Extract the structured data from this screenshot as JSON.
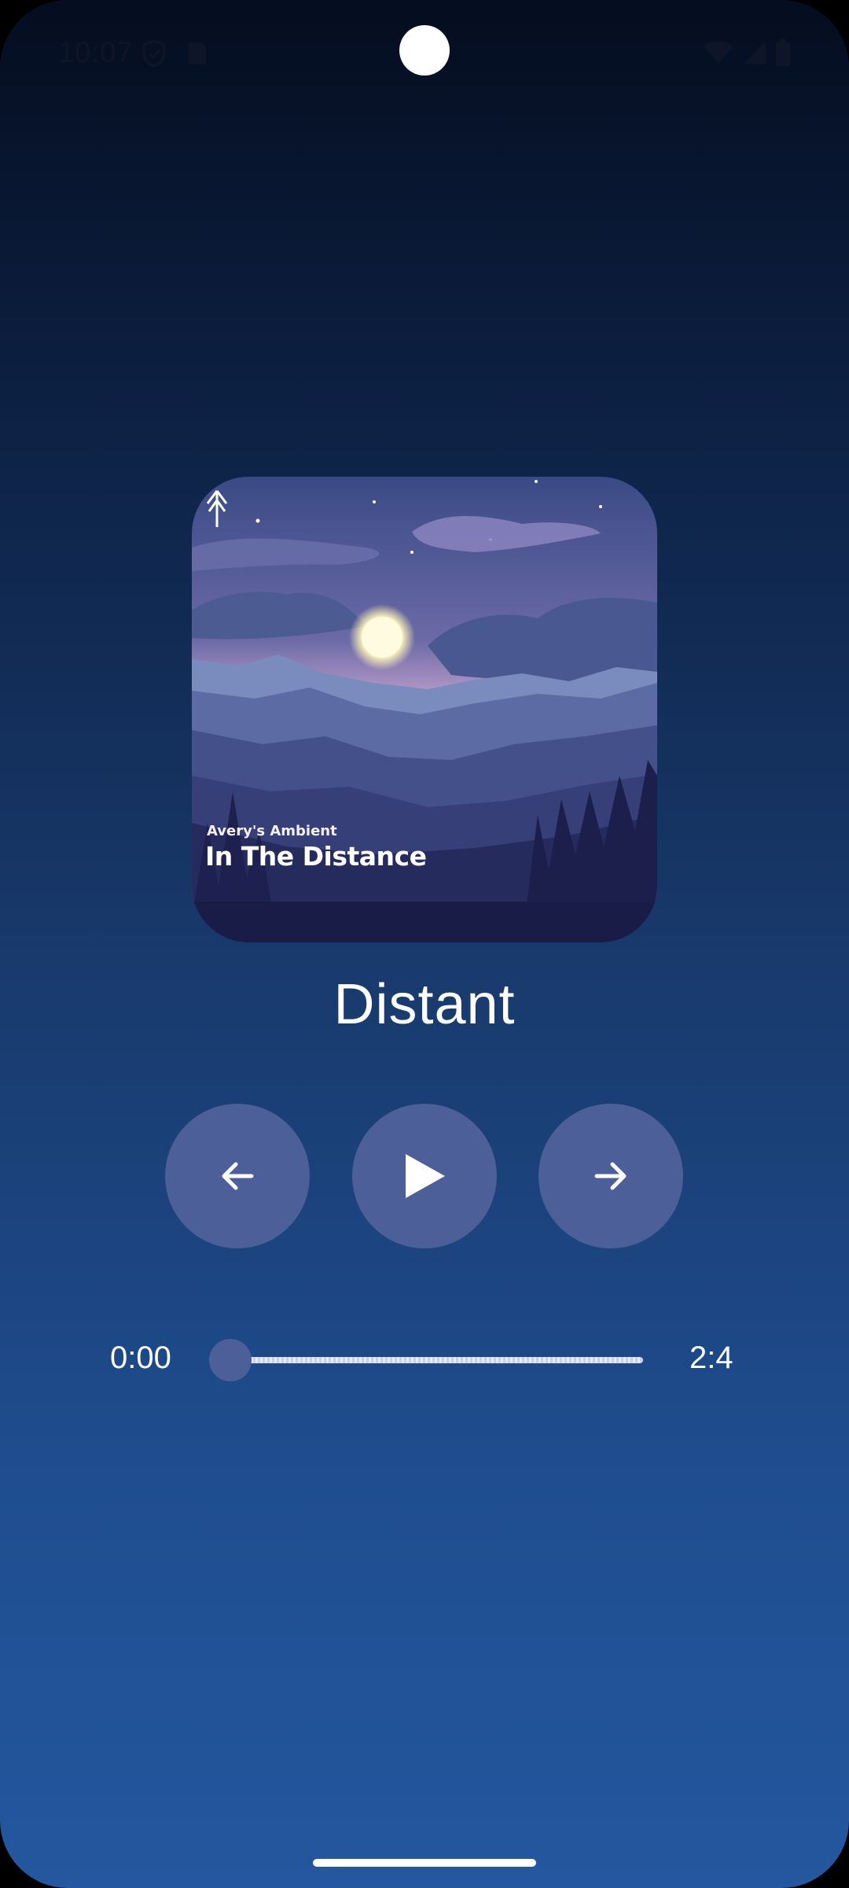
{
  "status_bar": {
    "time": "10:07",
    "icons": [
      "shield-icon",
      "sim-card-icon",
      "wifi-icon",
      "cell-signal-icon",
      "battery-icon"
    ]
  },
  "album": {
    "artist": "Avery's Ambient",
    "title": "In The Distance",
    "logo": "tree-logo-icon"
  },
  "player": {
    "track_title": "Distant",
    "prev_icon": "arrow-left-icon",
    "play_icon": "play-icon",
    "next_icon": "arrow-right-icon",
    "current_time": "0:00",
    "total_time": "2:4",
    "progress": 0
  },
  "colors": {
    "gradient_top": "#050d1f",
    "gradient_bottom": "#24579f",
    "button_fill": "#4c5f98",
    "text": "#ffffff"
  }
}
